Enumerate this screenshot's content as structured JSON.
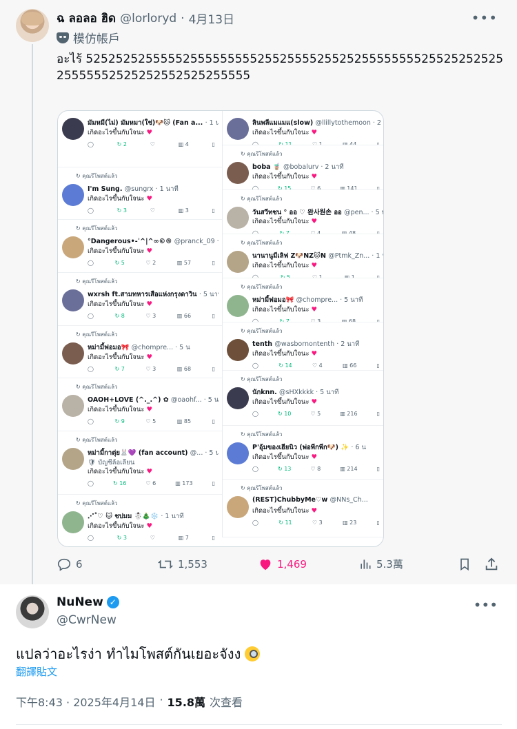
{
  "post1": {
    "name": "ฉ ลอลอ ฮิด",
    "handle": "@lorloryd",
    "date": "4月13日",
    "label": "模仿帳戶",
    "text": "อะไร้ 5252525255555255555555525525555255252555555552552525252525555552525252552525255555",
    "actions": {
      "replies": "6",
      "reposts": "1,553",
      "likes": "1,469",
      "views": "5.3萬"
    }
  },
  "screenshot": {
    "retweet_label": "คุณรีโพสต์แล้ว",
    "reply_text": "เกิดอะไรขึ้นกับใจนะ",
    "left": [
      {
        "name": "มัมหมี(ไม่) มัมหมา(ใช่)🐶🐱 (Fan a...",
        "handle": "· 1 นาที",
        "rt": "2",
        "likes": "",
        "views": "4"
      },
      {
        "name": "I'm Sung.",
        "handle": "@sungrx · 1 นาที",
        "rt": "3",
        "likes": "",
        "views": "3"
      },
      {
        "name": "°Dangerous•-ʾ^|^∞©®",
        "handle": "@pranck_09 · 5 น",
        "rt": "5",
        "likes": "2",
        "views": "57"
      },
      {
        "name": "wxrsh ft.สามทหารเสือแห่งกรุงดาวิน",
        "handle": "· 5 นาที",
        "rt": "8",
        "likes": "3",
        "views": "66"
      },
      {
        "name": "หม่ามี้ฟอมอ🎀",
        "handle": "@chompre... · 5 น",
        "rt": "7",
        "likes": "3",
        "views": "68"
      },
      {
        "name": "OAOH+LOVE (^._.^) ✿",
        "handle": "@oaohf... · 5 น",
        "rt": "9",
        "likes": "5",
        "views": "85"
      },
      {
        "name": "หม่ามี้กาตุ่ย🐰💜 (fan account)",
        "handle": "@... · 5 น",
        "rt": "16",
        "likes": "6",
        "views": "173"
      },
      {
        "name": "⋰˚♡ 🐱 ชปมม ☃️🎄❄️",
        "handle": "· 1 นาที",
        "rt": "3",
        "likes": "",
        "views": "7"
      }
    ],
    "right": [
      {
        "name": "ลินพลีแมแมแ(slow)",
        "handle": "@llillytothemoon · 2 นาที",
        "rt": "11",
        "likes": "1",
        "views": "44"
      },
      {
        "name": "boba 🧋",
        "handle": "@bobalurv · 2 นาที",
        "rt": "15",
        "likes": "6",
        "views": "141"
      },
      {
        "name": "วันสวีทชน ° ออ ♡ 완사원손 ออ",
        "handle": "@pen... · 5 นาที",
        "rt": "7",
        "likes": "4",
        "views": "48"
      },
      {
        "name": "นานานูมีเลิฟ Z🐶NZ🐱N",
        "handle": "@Ptmk_Zn... · 1 นาที",
        "rt": "5",
        "likes": "1",
        "views": "1"
      },
      {
        "name": "หม่ามี้ฟอมอ🎀",
        "handle": "@chompre... · 5 นาที",
        "rt": "7",
        "likes": "3",
        "views": "68"
      },
      {
        "name": "tenth",
        "handle": "@wasbornontenth · 2 นาที",
        "rt": "14",
        "likes": "4",
        "views": "66"
      },
      {
        "name": "นักknn.",
        "handle": "@sHXkkkk · 5 นาที",
        "rt": "10",
        "likes": "5",
        "views": "216"
      },
      {
        "name": "P'อุ้มของเฮียนิว (พ่อพีกพีก🐶) ✨",
        "handle": "· 6 น",
        "rt": "13",
        "likes": "8",
        "views": "214"
      },
      {
        "name": "(REST)ChubbyMe♡w",
        "handle": "@NNs_Ch...",
        "rt": "11",
        "likes": "3",
        "views": "23"
      }
    ],
    "extra_left_line": "🛡 บัญชีล้อเลียน"
  },
  "post2": {
    "name": "NuNew",
    "handle": "@CwrNew",
    "text": "แปลว่าอะไรง่า ทำไมโพสต์กันเยอะจังง",
    "translate": "翻譯貼文",
    "time": "下午8:43 · 2025年4月14日",
    "views_count": "15.8萬",
    "views_label": "次查看"
  },
  "colors": {
    "accent": "#1d9bf0",
    "like": "#f91880",
    "repost": "#00ba7c",
    "muted": "#536471"
  }
}
